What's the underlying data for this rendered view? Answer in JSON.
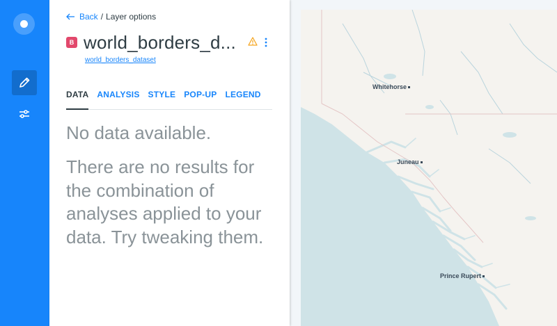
{
  "sidebar": {
    "items": [
      {
        "icon": "pencil-icon",
        "active": true
      },
      {
        "icon": "sliders-icon",
        "active": false
      }
    ]
  },
  "breadcrumb": {
    "back_label": "Back",
    "separator": "/",
    "current": "Layer options"
  },
  "layer": {
    "badge": "B",
    "title": "world_borders_d...",
    "source": "world_borders_dataset"
  },
  "tabs": [
    {
      "label": "DATA",
      "active": true
    },
    {
      "label": "ANALYSIS",
      "active": false
    },
    {
      "label": "STYLE",
      "active": false
    },
    {
      "label": "POP-UP",
      "active": false
    },
    {
      "label": "LEGEND",
      "active": false
    }
  ],
  "empty_state": {
    "title": "No data available.",
    "message": "There are no results for the combination of analyses applied to your data. Try tweaking them."
  },
  "map": {
    "cities": [
      "Whitehorse",
      "Juneau",
      "Prince Rupert"
    ]
  },
  "colors": {
    "brand": "#1785fb",
    "badge": "#e2486c",
    "warning": "#f5a623",
    "water": "#cfe3e7",
    "land": "#f5f3ef"
  }
}
